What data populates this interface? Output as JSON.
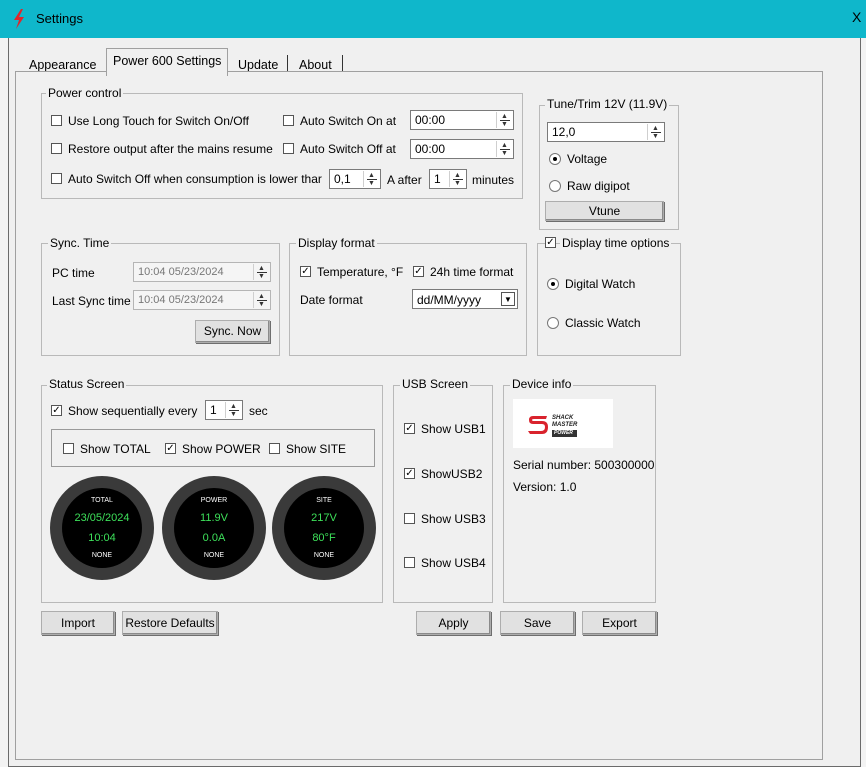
{
  "window": {
    "title": "Settings",
    "close_glyph": "X"
  },
  "tabs": [
    {
      "label": "Appearance"
    },
    {
      "label": "Power 600 Settings"
    },
    {
      "label": "Update"
    },
    {
      "label": "About"
    }
  ],
  "power_control": {
    "title": "Power control",
    "long_touch_label": "Use Long Touch for Switch On/Off",
    "restore_output_label": "Restore output after the mains resume",
    "auto_off_consumption_label": "Auto Switch Off when consumption is lower thar",
    "auto_on_label": "Auto Switch On at",
    "auto_on_value": "00:00",
    "auto_off_label": "Auto Switch Off at",
    "auto_off_value": "00:00",
    "current_value": "0,1",
    "a_after_label": "A after",
    "minutes_value": "1",
    "minutes_label": "minutes"
  },
  "tune_trim": {
    "title": "Tune/Trim 12V (11.9V)",
    "value": "12,0",
    "voltage_label": "Voltage",
    "raw_label": "Raw digipot",
    "vtune_label": "Vtune"
  },
  "sync_time": {
    "title": "Sync. Time",
    "pc_time_label": "PC time",
    "pc_time_value": "10:04 05/23/2024",
    "last_sync_label": "Last Sync time",
    "last_sync_value": "10:04 05/23/2024",
    "sync_now_label": "Sync. Now"
  },
  "display_format": {
    "title": "Display format",
    "temperature_label": "Temperature, °F",
    "h24_label": "24h time format",
    "date_format_label": "Date format",
    "date_format_value": "dd/MM/yyyy"
  },
  "display_time_options": {
    "title": "Display time options",
    "digital_label": "Digital Watch",
    "classic_label": "Classic Watch"
  },
  "status_screen": {
    "title": "Status Screen",
    "show_seq_label": "Show sequentially every",
    "seq_value": "1",
    "sec_label": "sec",
    "show_total_label": "Show TOTAL",
    "show_power_label": "Show POWER",
    "show_site_label": "Show SITE",
    "watches": [
      {
        "top": "TOTAL",
        "line1": "23/05/2024",
        "line2": "10:04",
        "bottom": "NONE"
      },
      {
        "top": "POWER",
        "line1": "11.9V",
        "line2": "0.0A",
        "bottom": "NONE"
      },
      {
        "top": "SITE",
        "line1": "217V",
        "line2": "80°F",
        "bottom": "NONE"
      }
    ]
  },
  "usb_screen": {
    "title": "USB Screen",
    "usb1": "Show USB1",
    "usb2": "ShowUSB2",
    "usb3": "Show USB3",
    "usb4": "Show USB4"
  },
  "device_info": {
    "title": "Device info",
    "logo_text_1": "SHACK",
    "logo_text_2": "MASTER",
    "logo_text_3": "POWER",
    "serial_label": "Serial number: 500300000",
    "version_label": "Version: 1.0"
  },
  "buttons": {
    "import": "Import",
    "restore_defaults": "Restore Defaults",
    "apply": "Apply",
    "save": "Save",
    "export": "Export"
  },
  "colors": {
    "titlebar": "#0fb7cb",
    "watch_text": "#3de05a",
    "logo_red": "#d9232d"
  }
}
